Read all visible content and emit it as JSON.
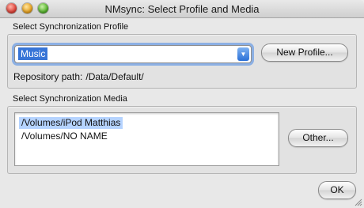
{
  "window": {
    "title": "NMsync: Select Profile and Media"
  },
  "profile": {
    "group_label": "Select Synchronization Profile",
    "selected_profile": "Music",
    "new_profile_label": "New Profile...",
    "repository_label": "Repository path:",
    "repository_value": "/Data/Default/"
  },
  "media": {
    "group_label": "Select Synchronization Media",
    "items": [
      {
        "label": "/Volumes/iPod Matthias",
        "selected": true
      },
      {
        "label": "/Volumes/NO NAME",
        "selected": false
      }
    ],
    "other_label": "Other..."
  },
  "footer": {
    "ok_label": "OK"
  },
  "colors": {
    "selection_active": "#3875d7",
    "selection_inactive": "#b5d3ff",
    "focus_ring": "#8cb0e4"
  },
  "icons": {
    "popup_arrow": "chevron-down-icon",
    "resize": "resize-grip-icon"
  }
}
